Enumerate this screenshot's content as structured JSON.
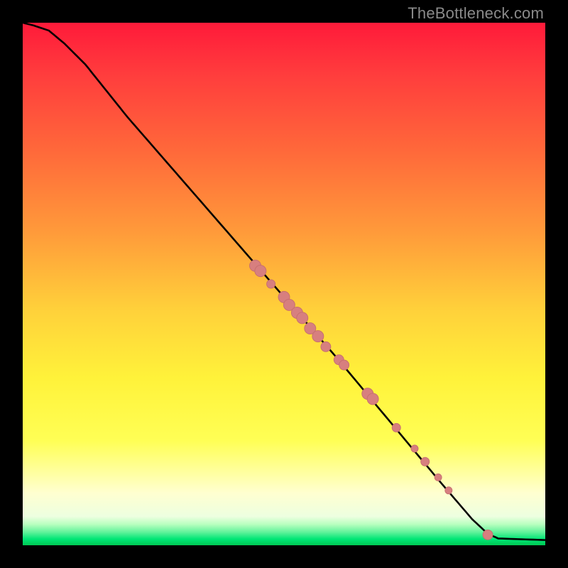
{
  "watermark": "TheBottleneck.com",
  "colors": {
    "frame": "#000000",
    "curve_stroke": "#000000",
    "marker_fill": "#d77f7f",
    "marker_stroke": "#c56e6e",
    "gradient_stops": [
      {
        "offset": 0.0,
        "color": "#ff1a3a"
      },
      {
        "offset": 0.1,
        "color": "#ff3d3d"
      },
      {
        "offset": 0.25,
        "color": "#ff6a3a"
      },
      {
        "offset": 0.4,
        "color": "#ff9a3a"
      },
      {
        "offset": 0.55,
        "color": "#ffd13a"
      },
      {
        "offset": 0.68,
        "color": "#fff23a"
      },
      {
        "offset": 0.8,
        "color": "#ffff55"
      },
      {
        "offset": 0.9,
        "color": "#ffffd0"
      },
      {
        "offset": 0.945,
        "color": "#edffe0"
      },
      {
        "offset": 0.96,
        "color": "#b8ffbf"
      },
      {
        "offset": 0.975,
        "color": "#60f29a"
      },
      {
        "offset": 0.988,
        "color": "#00e676"
      },
      {
        "offset": 1.0,
        "color": "#00c853"
      }
    ]
  },
  "chart_data": {
    "type": "line",
    "title": "",
    "xlabel": "",
    "ylabel": "",
    "xlim": [
      0,
      100
    ],
    "ylim": [
      0,
      100
    ],
    "series": [
      {
        "name": "curve",
        "x": [
          0,
          2,
          5,
          8,
          12,
          20,
          30,
          40,
          50,
          60,
          70,
          80,
          86,
          89,
          91,
          100
        ],
        "y": [
          100,
          99.5,
          98.5,
          96,
          92,
          82,
          70.5,
          59,
          47.5,
          36,
          24,
          12,
          5,
          2.2,
          1.3,
          1.0
        ]
      }
    ],
    "markers": [
      {
        "x": 44.5,
        "y": 53.5,
        "r": 8
      },
      {
        "x": 45.5,
        "y": 52.5,
        "r": 8
      },
      {
        "x": 47.5,
        "y": 50.0,
        "r": 6
      },
      {
        "x": 50.0,
        "y": 47.5,
        "r": 8
      },
      {
        "x": 51.0,
        "y": 46.0,
        "r": 8
      },
      {
        "x": 52.5,
        "y": 44.5,
        "r": 8
      },
      {
        "x": 53.5,
        "y": 43.5,
        "r": 8
      },
      {
        "x": 55.0,
        "y": 41.5,
        "r": 8
      },
      {
        "x": 56.5,
        "y": 40.0,
        "r": 8
      },
      {
        "x": 58.0,
        "y": 38.0,
        "r": 7
      },
      {
        "x": 60.5,
        "y": 35.5,
        "r": 7
      },
      {
        "x": 61.5,
        "y": 34.5,
        "r": 7
      },
      {
        "x": 66.0,
        "y": 29.0,
        "r": 8
      },
      {
        "x": 67.0,
        "y": 28.0,
        "r": 8
      },
      {
        "x": 71.5,
        "y": 22.5,
        "r": 6
      },
      {
        "x": 75.0,
        "y": 18.5,
        "r": 5
      },
      {
        "x": 77.0,
        "y": 16.0,
        "r": 6
      },
      {
        "x": 79.5,
        "y": 13.0,
        "r": 5
      },
      {
        "x": 81.5,
        "y": 10.5,
        "r": 5
      },
      {
        "x": 89.0,
        "y": 2.0,
        "r": 7
      }
    ]
  }
}
